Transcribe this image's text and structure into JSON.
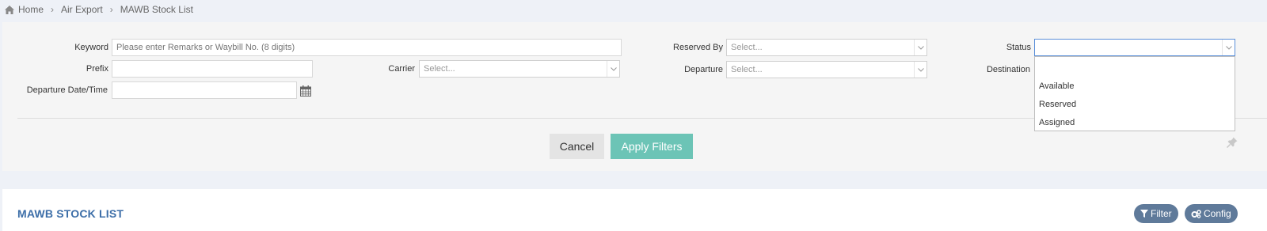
{
  "breadcrumb": {
    "home": "Home",
    "level1": "Air Export",
    "current": "MAWB Stock List"
  },
  "filters": {
    "keyword": {
      "label": "Keyword",
      "placeholder": "Please enter Remarks or Waybill No. (8 digits)"
    },
    "prefix": {
      "label": "Prefix",
      "value": ""
    },
    "carrier": {
      "label": "Carrier",
      "placeholder": "Select..."
    },
    "departure_datetime": {
      "label": "Departure Date/Time",
      "value": ""
    },
    "reserved_by": {
      "label": "Reserved By",
      "placeholder": "Select..."
    },
    "departure": {
      "label": "Departure",
      "placeholder": "Select..."
    },
    "status": {
      "label": "Status",
      "value": ""
    },
    "destination": {
      "label": "Destination"
    }
  },
  "status_dropdown": {
    "options": [
      "",
      "Available",
      "Reserved",
      "Assigned"
    ]
  },
  "actions": {
    "cancel": "Cancel",
    "apply": "Apply Filters"
  },
  "list": {
    "title": "MAWB STOCK LIST",
    "filter_button": "Filter",
    "config_button": "Config"
  },
  "colors": {
    "accent_teal": "#6cc4b6",
    "title_blue": "#3c6ea8",
    "pill": "#5f7a9a"
  }
}
